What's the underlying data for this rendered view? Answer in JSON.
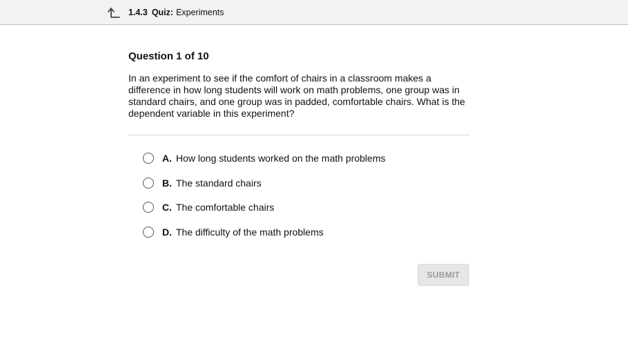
{
  "header": {
    "lesson_number": "1.4.3",
    "type_label": "Quiz:",
    "title": "Experiments",
    "back_icon": "back-arrow-up-icon"
  },
  "question": {
    "title": "Question 1 of 10",
    "prompt": "In an experiment to see if the comfort of chairs in a classroom makes a difference in how long students will work on math problems, one group was in standard chairs, and one group was in padded, comfortable chairs. What is the dependent variable in this experiment?"
  },
  "options": [
    {
      "letter": "A.",
      "text": "How long students worked on the math problems",
      "selected": false
    },
    {
      "letter": "B.",
      "text": "The standard chairs",
      "selected": false
    },
    {
      "letter": "C.",
      "text": "The comfortable chairs",
      "selected": false
    },
    {
      "letter": "D.",
      "text": "The difficulty of the math problems",
      "selected": false
    }
  ],
  "submit": {
    "label": "SUBMIT",
    "enabled": false
  }
}
